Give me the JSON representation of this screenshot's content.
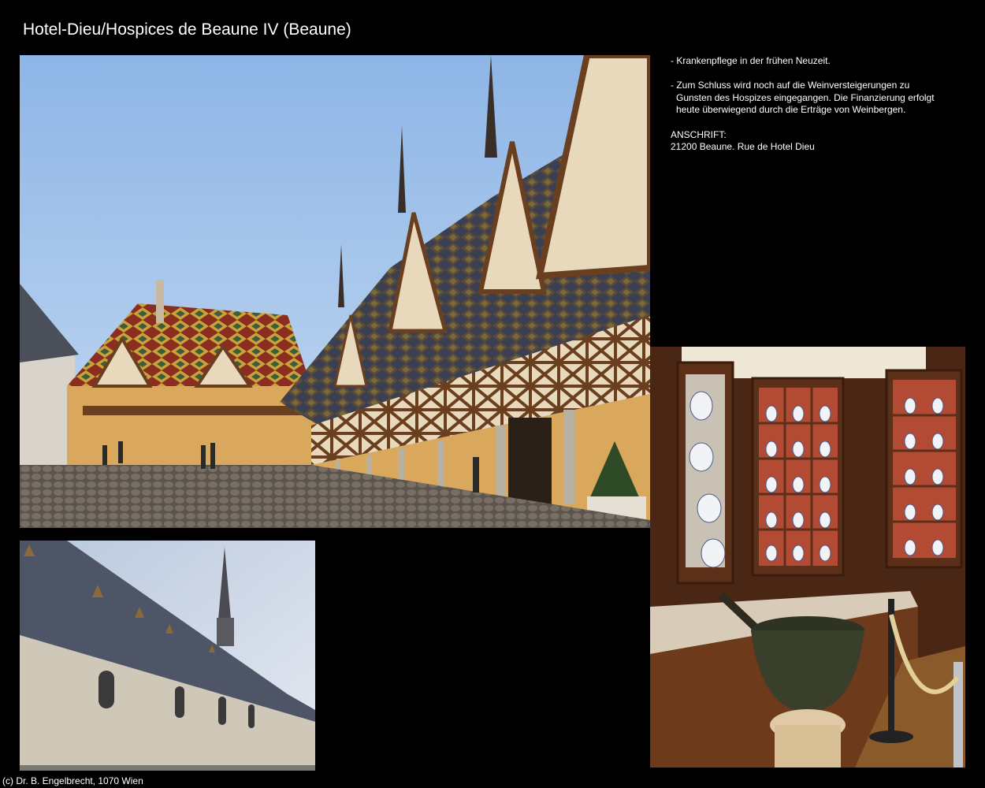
{
  "page": {
    "title": "Hotel-Dieu/Hospices de Beaune IV (Beaune)",
    "footer": "(c) Dr. B. Engelbrecht, 1070 Wien"
  },
  "description": {
    "bullet_1": "- Krankenpflege in der frühen Neuzeit.",
    "bullet_2": "- Zum Schluss wird noch auf die Weinversteigerungen zu Gunsten des Hospizes eingegangen. Die Finanzierung erfolgt heute überwiegend durch die Erträge von Weinbergen.",
    "address_label": "ANSCHRIFT:",
    "address": "21200 Beaune. Rue de Hotel Dieu"
  },
  "colors": {
    "background": "#000000",
    "text": "#ffffff",
    "sky": "#a9c6ea",
    "roof_tile_gold": "#c9a23a",
    "roof_tile_green": "#3f5d3a",
    "roof_tile_red": "#9b3b2a",
    "timber_brown": "#6a3f1f",
    "wall_ochre": "#d9a85c",
    "cobblestone": "#6b625a",
    "wood_cabinet": "#5b2f18",
    "shelf_red": "#b24a34",
    "slate_roof": "#4d5566",
    "stone_wall": "#cfc8b8"
  },
  "images": {
    "courtyard": "courtyard-photo",
    "church": "church-roof-photo",
    "pharmacy": "pharmacy-photo"
  }
}
